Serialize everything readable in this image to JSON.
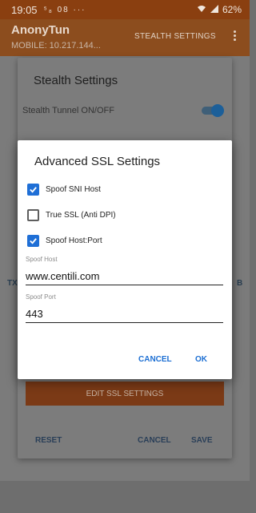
{
  "status": {
    "time": "19:05",
    "left_icons": "⁵₈  08  ···",
    "battery": "62%"
  },
  "appbar": {
    "title": "AnonyTun",
    "subtitle": "MOBILE: 10.217.144...",
    "action_label": "STEALTH SETTINGS"
  },
  "main": {
    "left_fragment": "TX",
    "right_fragment": "B"
  },
  "stealth_dialog": {
    "title": "Stealth Settings",
    "tunnel_label": "Stealth Tunnel ON/OFF",
    "tunnel_on": true,
    "edit_ssl_label": "EDIT SSL SETTINGS",
    "reset_label": "RESET",
    "cancel_label": "CANCEL",
    "save_label": "SAVE"
  },
  "advanced_dialog": {
    "title": "Advanced SSL Settings",
    "options": [
      {
        "label": "Spoof SNI Host",
        "checked": true
      },
      {
        "label": "True SSL (Anti DPI)",
        "checked": false
      },
      {
        "label": "Spoof Host:Port",
        "checked": true
      }
    ],
    "spoof_host_label": "Spoof Host",
    "spoof_host_value": "www.centili.com",
    "spoof_port_label": "Spoof Port",
    "spoof_port_value": "443",
    "cancel_label": "CANCEL",
    "ok_label": "OK"
  },
  "colors": {
    "accent": "#1f6fd6",
    "appbar": "#8c4d1e"
  }
}
